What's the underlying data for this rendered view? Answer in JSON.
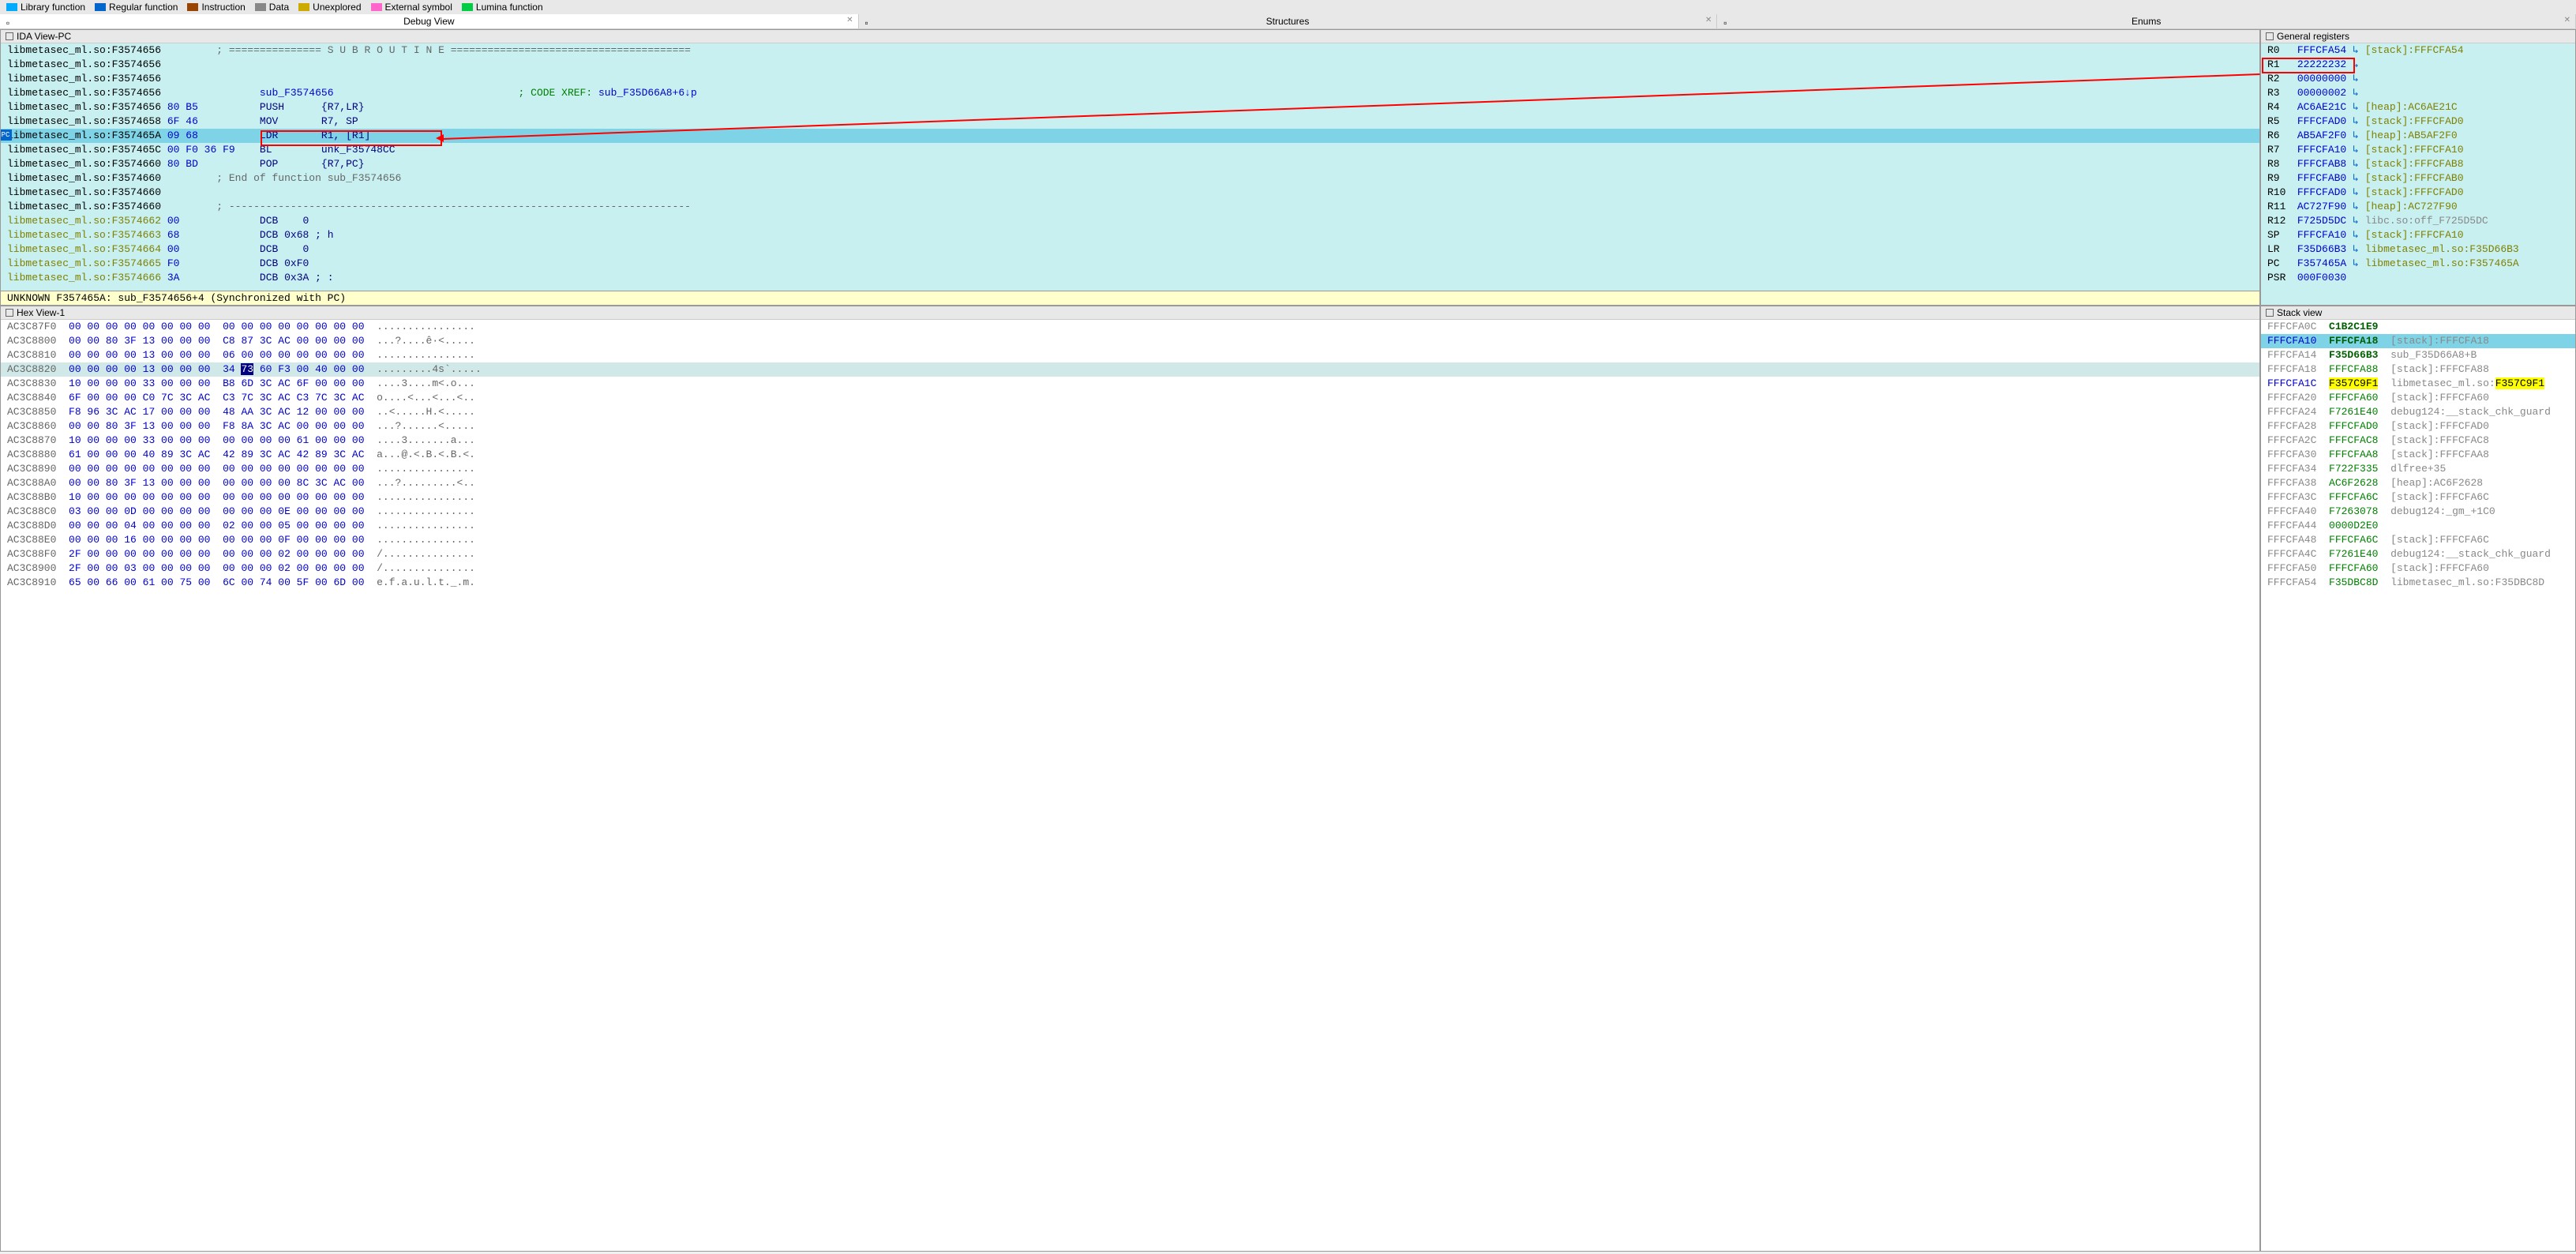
{
  "legend": [
    {
      "color": "#00aaff",
      "label": "Library function"
    },
    {
      "color": "#0066cc",
      "label": "Regular function"
    },
    {
      "color": "#994400",
      "label": "Instruction"
    },
    {
      "color": "#888888",
      "label": "Data"
    },
    {
      "color": "#ccaa00",
      "label": "Unexplored"
    },
    {
      "color": "#ff66cc",
      "label": "External symbol"
    },
    {
      "color": "#00cc44",
      "label": "Lumina function"
    }
  ],
  "tabs": [
    {
      "label": "Debug View",
      "active": true,
      "closable": true
    },
    {
      "label": "Structures",
      "active": false,
      "closable": true
    },
    {
      "label": "Enums",
      "active": false,
      "closable": true
    }
  ],
  "panes": {
    "disasm_title": "IDA View-PC",
    "regs_title": "General registers",
    "hex_title": "Hex View-1",
    "stack_title": "Stack view"
  },
  "disasm": {
    "status": "UNKNOWN F357465A: sub_F3574656+4 (Synchronized with PC)",
    "lines": [
      {
        "addr": "libmetasec_ml.so:F3574656",
        "bytes": "",
        "text": "; =============== S U B R O U T I N E =======================================",
        "type": "comment"
      },
      {
        "addr": "libmetasec_ml.so:F3574656",
        "bytes": "",
        "text": "",
        "type": "blank"
      },
      {
        "addr": "libmetasec_ml.so:F3574656",
        "bytes": "",
        "text": "",
        "type": "blank"
      },
      {
        "addr": "libmetasec_ml.so:F3574656",
        "bytes": "",
        "label": "sub_F3574656",
        "xref": "; CODE XREF: sub_F35D66A8+6↓p",
        "type": "label"
      },
      {
        "addr": "libmetasec_ml.so:F3574656",
        "bytes": "80 B5",
        "mnem": "PUSH",
        "ops": "{R7,LR}",
        "type": "insn"
      },
      {
        "addr": "libmetasec_ml.so:F3574658",
        "bytes": "6F 46",
        "mnem": "MOV",
        "ops": "R7, SP",
        "type": "insn"
      },
      {
        "addr": "libmetasec_ml.so:F357465A",
        "bytes": "09 68",
        "mnem": "LDR",
        "ops": "R1, [R1]",
        "type": "insn",
        "current": true,
        "redbox": true
      },
      {
        "addr": "libmetasec_ml.so:F357465C",
        "bytes": "00 F0 36 F9",
        "mnem": "BL",
        "ops": "unk_F35748CC",
        "type": "insn"
      },
      {
        "addr": "libmetasec_ml.so:F3574660",
        "bytes": "80 BD",
        "mnem": "POP",
        "ops": "{R7,PC}",
        "type": "insn"
      },
      {
        "addr": "libmetasec_ml.so:F3574660",
        "bytes": "",
        "text": "; End of function sub_F3574656",
        "type": "comment"
      },
      {
        "addr": "libmetasec_ml.so:F3574660",
        "bytes": "",
        "text": "",
        "type": "blank"
      },
      {
        "addr": "libmetasec_ml.so:F3574660",
        "bytes": "",
        "text": "; ---------------------------------------------------------------------------",
        "type": "comment"
      },
      {
        "addr": "libmetasec_ml.so:F3574662",
        "bytes": "00",
        "mnem": "DCB",
        "ops": "   0",
        "type": "dcb",
        "yellow": true
      },
      {
        "addr": "libmetasec_ml.so:F3574663",
        "bytes": "68",
        "mnem": "DCB",
        "ops": "0x68 ; h",
        "type": "dcb",
        "yellow": true
      },
      {
        "addr": "libmetasec_ml.so:F3574664",
        "bytes": "00",
        "mnem": "DCB",
        "ops": "   0",
        "type": "dcb",
        "yellow": true
      },
      {
        "addr": "libmetasec_ml.so:F3574665",
        "bytes": "F0",
        "mnem": "DCB",
        "ops": "0xF0",
        "type": "dcb",
        "yellow": true
      },
      {
        "addr": "libmetasec_ml.so:F3574666",
        "bytes": "3A",
        "mnem": "DCB",
        "ops": "0x3A ; :",
        "type": "dcb",
        "yellow": true
      }
    ]
  },
  "registers": [
    {
      "name": "R0",
      "val": "FFFCFA54",
      "arrow": true,
      "desc": "[stack]:FFFCFA54"
    },
    {
      "name": "R1",
      "val": "22222232",
      "arrow": true,
      "desc": "",
      "redbox": true
    },
    {
      "name": "R2",
      "val": "00000000",
      "arrow": true,
      "desc": ""
    },
    {
      "name": "R3",
      "val": "00000002",
      "arrow": true,
      "desc": ""
    },
    {
      "name": "R4",
      "val": "AC6AE21C",
      "arrow": true,
      "desc": "[heap]:AC6AE21C"
    },
    {
      "name": "R5",
      "val": "FFFCFAD0",
      "arrow": true,
      "desc": "[stack]:FFFCFAD0"
    },
    {
      "name": "R6",
      "val": "AB5AF2F0",
      "arrow": true,
      "desc": "[heap]:AB5AF2F0"
    },
    {
      "name": "R7",
      "val": "FFFCFA10",
      "arrow": true,
      "desc": "[stack]:FFFCFA10"
    },
    {
      "name": "R8",
      "val": "FFFCFAB8",
      "arrow": true,
      "desc": "[stack]:FFFCFAB8"
    },
    {
      "name": "R9",
      "val": "FFFCFAB0",
      "arrow": true,
      "desc": "[stack]:FFFCFAB0"
    },
    {
      "name": "R10",
      "val": "FFFCFAD0",
      "arrow": true,
      "desc": "[stack]:FFFCFAD0"
    },
    {
      "name": "R11",
      "val": "AC727F90",
      "arrow": true,
      "desc": "[heap]:AC727F90"
    },
    {
      "name": "R12",
      "val": "F725D5DC",
      "arrow": true,
      "desc": "libc.so:off_F725D5DC",
      "gray": true
    },
    {
      "name": "SP",
      "val": "FFFCFA10",
      "arrow": true,
      "desc": "[stack]:FFFCFA10"
    },
    {
      "name": "LR",
      "val": "F35D66B3",
      "arrow": true,
      "desc": "libmetasec_ml.so:F35D66B3"
    },
    {
      "name": "PC",
      "val": "F357465A",
      "arrow": true,
      "desc": "libmetasec_ml.so:F357465A"
    },
    {
      "name": "PSR",
      "val": "000F0030",
      "arrow": false,
      "desc": ""
    }
  ],
  "hex": [
    {
      "addr": "AC3C87F0",
      "bytes": "00 00 00 00 00 00 00 00  00 00 00 00 00 00 00 00",
      "ascii": "................"
    },
    {
      "addr": "AC3C8800",
      "bytes": "00 00 80 3F 13 00 00 00  C8 87 3C AC 00 00 00 00",
      "ascii": "...?....ê·<....."
    },
    {
      "addr": "AC3C8810",
      "bytes": "00 00 00 00 13 00 00 00  06 00 00 00 00 00 00 00",
      "ascii": "................"
    },
    {
      "addr": "AC3C8820",
      "bytes": "00 00 00 00 13 00 00 00  34 73 60 F3 00 40 00 00",
      "ascii": ".........4s`.....",
      "hl": true,
      "hlcol": 9
    },
    {
      "addr": "AC3C8830",
      "bytes": "10 00 00 00 33 00 00 00  B8 6D 3C AC 6F 00 00 00",
      "ascii": "....3....m<.o..."
    },
    {
      "addr": "AC3C8840",
      "bytes": "6F 00 00 00 C0 7C 3C AC  C3 7C 3C AC C3 7C 3C AC",
      "ascii": "o....<...<...<.."
    },
    {
      "addr": "AC3C8850",
      "bytes": "F8 96 3C AC 17 00 00 00  48 AA 3C AC 12 00 00 00",
      "ascii": "..<.....H.<....."
    },
    {
      "addr": "AC3C8860",
      "bytes": "00 00 80 3F 13 00 00 00  F8 8A 3C AC 00 00 00 00",
      "ascii": "...?......<....."
    },
    {
      "addr": "AC3C8870",
      "bytes": "10 00 00 00 33 00 00 00  00 00 00 00 61 00 00 00",
      "ascii": "....3.......a..."
    },
    {
      "addr": "AC3C8880",
      "bytes": "61 00 00 00 40 89 3C AC  42 89 3C AC 42 89 3C AC",
      "ascii": "a...@.<.B.<.B.<."
    },
    {
      "addr": "AC3C8890",
      "bytes": "00 00 00 00 00 00 00 00  00 00 00 00 00 00 00 00",
      "ascii": "................"
    },
    {
      "addr": "AC3C88A0",
      "bytes": "00 00 80 3F 13 00 00 00  00 00 00 00 8C 3C AC 00",
      "ascii": "...?.........<.."
    },
    {
      "addr": "AC3C88B0",
      "bytes": "10 00 00 00 00 00 00 00  00 00 00 00 00 00 00 00",
      "ascii": "................"
    },
    {
      "addr": "AC3C88C0",
      "bytes": "03 00 00 0D 00 00 00 00  00 00 00 0E 00 00 00 00",
      "ascii": "................"
    },
    {
      "addr": "AC3C88D0",
      "bytes": "00 00 00 04 00 00 00 00  02 00 00 05 00 00 00 00",
      "ascii": "................"
    },
    {
      "addr": "AC3C88E0",
      "bytes": "00 00 00 16 00 00 00 00  00 00 00 0F 00 00 00 00",
      "ascii": "................"
    },
    {
      "addr": "AC3C88F0",
      "bytes": "2F 00 00 00 00 00 00 00  00 00 00 02 00 00 00 00",
      "ascii": "/..............."
    },
    {
      "addr": "AC3C8900",
      "bytes": "2F 00 00 03 00 00 00 00  00 00 00 02 00 00 00 00",
      "ascii": "/..............."
    },
    {
      "addr": "AC3C8910",
      "bytes": "65 00 66 00 61 00 75 00  6C 00 74 00 5F 00 6D 00",
      "ascii": "e.f.a.u.l.t._.m."
    }
  ],
  "stack": [
    {
      "addr": "FFFCFA0C",
      "val": "C1B2C1E9",
      "desc": "",
      "gray": true,
      "valbold": true
    },
    {
      "addr": "FFFCFA10",
      "val": "FFFCFA18",
      "desc": "[stack]:FFFCFA18",
      "current": true,
      "addrblue": true,
      "valbold": true
    },
    {
      "addr": "FFFCFA14",
      "val": "F35D66B3",
      "desc": "sub_F35D66A8+B",
      "gray": true,
      "valbold": true
    },
    {
      "addr": "FFFCFA18",
      "val": "FFFCFA88",
      "desc": "[stack]:FFFCFA88",
      "gray": true
    },
    {
      "addr": "FFFCFA1C",
      "val": "F357C9F1",
      "desc": "libmetasec_ml.so:F357C9F1",
      "addrblue": true,
      "valhl": true,
      "deschl": "F357C9F1"
    },
    {
      "addr": "FFFCFA20",
      "val": "FFFCFA60",
      "desc": "[stack]:FFFCFA60",
      "gray": true
    },
    {
      "addr": "FFFCFA24",
      "val": "F7261E40",
      "desc": "debug124:__stack_chk_guard",
      "gray": true
    },
    {
      "addr": "FFFCFA28",
      "val": "FFFCFAD0",
      "desc": "[stack]:FFFCFAD0",
      "gray": true
    },
    {
      "addr": "FFFCFA2C",
      "val": "FFFCFAC8",
      "desc": "[stack]:FFFCFAC8",
      "gray": true
    },
    {
      "addr": "FFFCFA30",
      "val": "FFFCFAA8",
      "desc": "[stack]:FFFCFAA8",
      "gray": true
    },
    {
      "addr": "FFFCFA34",
      "val": "F722F335",
      "desc": "dlfree+35",
      "gray": true
    },
    {
      "addr": "FFFCFA38",
      "val": "AC6F2628",
      "desc": "[heap]:AC6F2628",
      "gray": true
    },
    {
      "addr": "FFFCFA3C",
      "val": "FFFCFA6C",
      "desc": "[stack]:FFFCFA6C",
      "gray": true
    },
    {
      "addr": "FFFCFA40",
      "val": "F7263078",
      "desc": "debug124:_gm_+1C0",
      "gray": true
    },
    {
      "addr": "FFFCFA44",
      "val": "0000D2E0",
      "desc": "",
      "gray": true
    },
    {
      "addr": "FFFCFA48",
      "val": "FFFCFA6C",
      "desc": "[stack]:FFFCFA6C",
      "gray": true
    },
    {
      "addr": "FFFCFA4C",
      "val": "F7261E40",
      "desc": "debug124:__stack_chk_guard",
      "gray": true
    },
    {
      "addr": "FFFCFA50",
      "val": "FFFCFA60",
      "desc": "[stack]:FFFCFA60",
      "gray": true
    },
    {
      "addr": "FFFCFA54",
      "val": "F35DBC8D",
      "desc": "libmetasec_ml.so:F35DBC8D",
      "gray": true
    }
  ]
}
